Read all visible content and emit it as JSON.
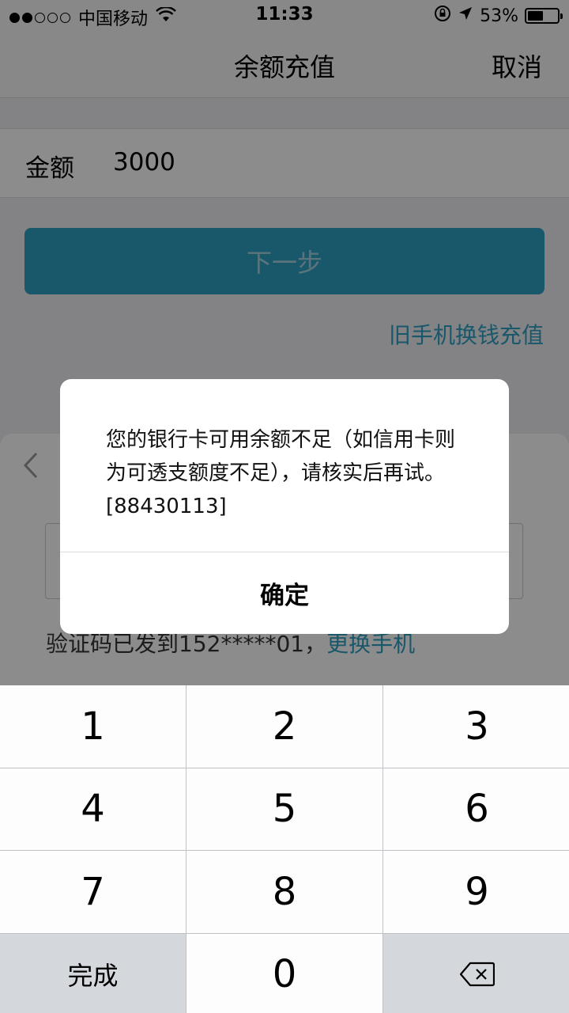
{
  "status_bar": {
    "carrier": "中国移动",
    "time": "11:33",
    "battery": "53%",
    "battery_level": 0.53
  },
  "nav": {
    "title": "余额充值",
    "cancel": "取消"
  },
  "amount": {
    "label": "金额",
    "value": "3000"
  },
  "next_button": "下一步",
  "old_phone_link": "旧手机换钱充值",
  "verification": {
    "sent_text": "验证码已发到152*****01，",
    "change_phone": "更换手机"
  },
  "alert": {
    "message": "您的银行卡可用余额不足（如信用卡则为可透支额度不足），请核实后再试。[88430113]",
    "ok": "确定"
  },
  "keyboard": {
    "k1": "1",
    "k2": "2",
    "k3": "3",
    "k4": "4",
    "k5": "5",
    "k6": "6",
    "k7": "7",
    "k8": "8",
    "k9": "9",
    "done": "完成",
    "k0": "0"
  },
  "icons": {
    "wifi": "wifi-icon",
    "lock_rotation": "rotation-lock-icon",
    "location": "location-arrow-icon",
    "back": "chevron-left-icon",
    "delete": "backspace-icon"
  }
}
